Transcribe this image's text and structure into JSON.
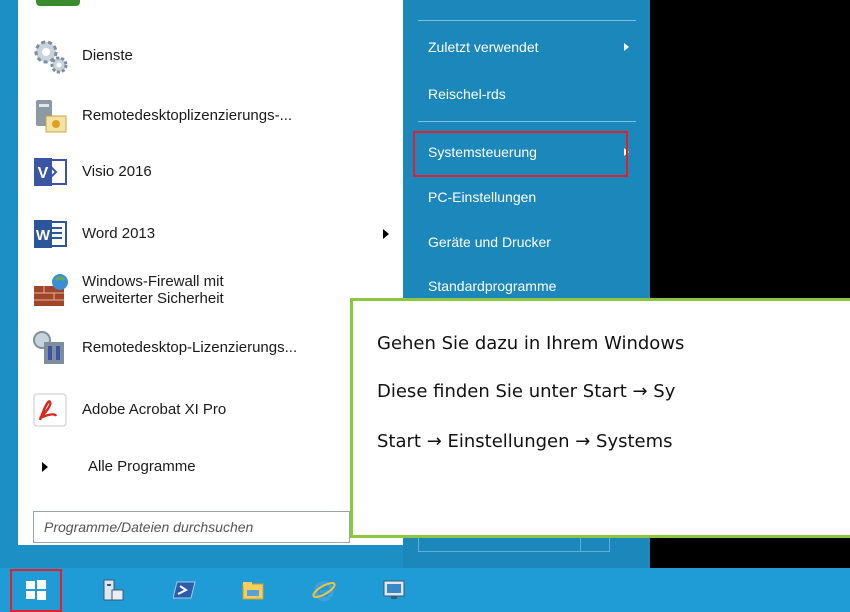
{
  "start_menu": {
    "apps": [
      {
        "label": "Dienste",
        "icon": "gears-icon"
      },
      {
        "label": "Remotedesktoplizenzierungs-...",
        "icon": "license-server-icon"
      },
      {
        "label": "Visio 2016",
        "icon": "visio-icon"
      },
      {
        "label": "Word 2013",
        "icon": "word-icon"
      },
      {
        "label_line1": "Windows-Firewall mit",
        "label_line2": "erweiterter Sicherheit",
        "icon": "firewall-icon"
      },
      {
        "label": "Remotedesktop-Lizenzierungs...",
        "icon": "rd-licensing-icon"
      },
      {
        "label": "Adobe Acrobat XI Pro",
        "icon": "acrobat-icon"
      }
    ],
    "all_programs": "Alle Programme",
    "search_placeholder": "Programme/Dateien durchsuchen"
  },
  "right_nav": {
    "items": [
      {
        "label": "Zuletzt verwendet",
        "has_submenu": true
      },
      {
        "label": "Reischel-rds"
      },
      {
        "label": "Systemsteuerung",
        "highlighted": true
      },
      {
        "label": "PC-Einstellungen"
      },
      {
        "label": "Geräte und Drucker"
      },
      {
        "label": "Standardprogramme"
      }
    ]
  },
  "callout": {
    "line1": "Gehen Sie dazu in Ihrem Windows",
    "line2": "Diese finden Sie unter Start → Sy",
    "line3": "Start → Einstellungen → Systems"
  },
  "taskbar": {
    "items": [
      "windows-start-icon",
      "server-manager-icon",
      "powershell-icon",
      "file-explorer-icon",
      "internet-explorer-icon",
      "remote-desktop-icon"
    ]
  },
  "colors": {
    "accent_blue": "#1b87ba",
    "taskbar_blue": "#1f9bd6",
    "highlight_red": "#e0212b",
    "callout_border": "#8dc63f"
  }
}
